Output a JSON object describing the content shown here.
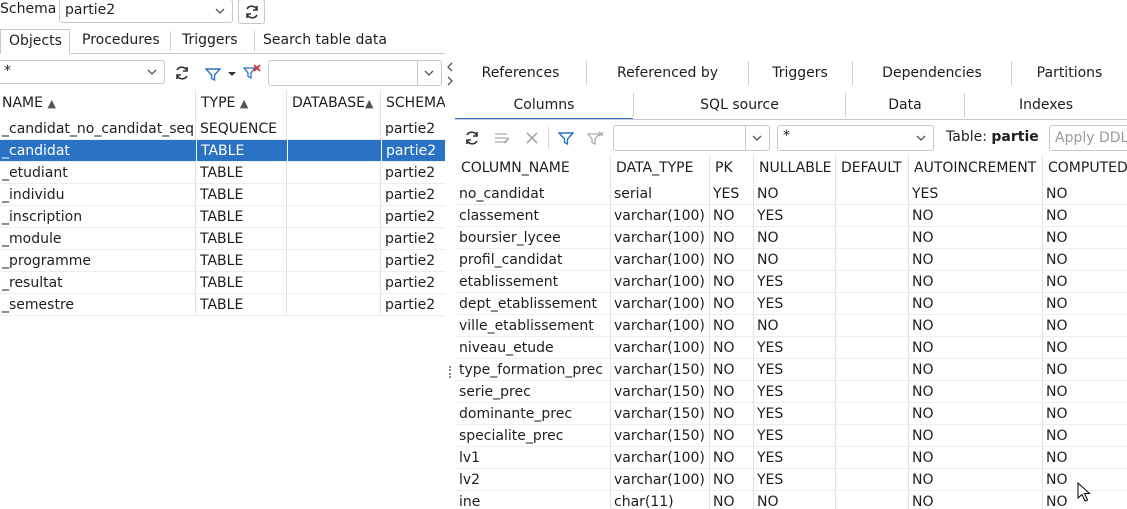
{
  "schema_bar": {
    "label": "Schema",
    "selected": "partie2"
  },
  "nav_tabs": [
    "Objects",
    "Procedures",
    "Triggers",
    "Search table data"
  ],
  "left_filter": {
    "value": "*",
    "search_value": ""
  },
  "objects_table": {
    "headers": [
      "NAME",
      "TYPE",
      "DATABASE",
      "SCHEMA"
    ],
    "rows": [
      {
        "name": "_candidat_no_candidat_seq",
        "type": "SEQUENCE",
        "database": "",
        "schema": "partie2"
      },
      {
        "name": "_candidat",
        "type": "TABLE",
        "database": "",
        "schema": "partie2"
      },
      {
        "name": "_etudiant",
        "type": "TABLE",
        "database": "",
        "schema": "partie2"
      },
      {
        "name": "_individu",
        "type": "TABLE",
        "database": "",
        "schema": "partie2"
      },
      {
        "name": "_inscription",
        "type": "TABLE",
        "database": "",
        "schema": "partie2"
      },
      {
        "name": "_module",
        "type": "TABLE",
        "database": "",
        "schema": "partie2"
      },
      {
        "name": "_programme",
        "type": "TABLE",
        "database": "",
        "schema": "partie2"
      },
      {
        "name": "_resultat",
        "type": "TABLE",
        "database": "",
        "schema": "partie2"
      },
      {
        "name": "_semestre",
        "type": "TABLE",
        "database": "",
        "schema": "partie2"
      }
    ],
    "selected_index": 1
  },
  "detail_tabs_row1": [
    "References",
    "Referenced by",
    "Triggers",
    "Dependencies",
    "Partitions"
  ],
  "detail_tabs_row2": [
    "Columns",
    "SQL source",
    "Data",
    "Indexes"
  ],
  "detail_toolbar": {
    "filter_value": "",
    "pattern_value": "*",
    "table_label": "Table:",
    "table_name": "partie",
    "apply_ddl": "Apply DDL"
  },
  "columns_table": {
    "headers": [
      "COLUMN_NAME",
      "DATA_TYPE",
      "PK",
      "NULLABLE",
      "DEFAULT",
      "AUTOINCREMENT",
      "COMPUTED"
    ],
    "rows": [
      [
        "no_candidat",
        "serial",
        "YES",
        "NO",
        "",
        "YES",
        "NO"
      ],
      [
        "classement",
        "varchar(100)",
        "NO",
        "YES",
        "",
        "NO",
        "NO"
      ],
      [
        "boursier_lycee",
        "varchar(100)",
        "NO",
        "NO",
        "",
        "NO",
        "NO"
      ],
      [
        "profil_candidat",
        "varchar(100)",
        "NO",
        "NO",
        "",
        "NO",
        "NO"
      ],
      [
        "etablissement",
        "varchar(100)",
        "NO",
        "YES",
        "",
        "NO",
        "NO"
      ],
      [
        "dept_etablissement",
        "varchar(100)",
        "NO",
        "YES",
        "",
        "NO",
        "NO"
      ],
      [
        "ville_etablissement",
        "varchar(100)",
        "NO",
        "NO",
        "",
        "NO",
        "NO"
      ],
      [
        "niveau_etude",
        "varchar(100)",
        "NO",
        "YES",
        "",
        "NO",
        "NO"
      ],
      [
        "type_formation_prec",
        "varchar(150)",
        "NO",
        "YES",
        "",
        "NO",
        "NO"
      ],
      [
        "serie_prec",
        "varchar(150)",
        "NO",
        "YES",
        "",
        "NO",
        "NO"
      ],
      [
        "dominante_prec",
        "varchar(150)",
        "NO",
        "YES",
        "",
        "NO",
        "NO"
      ],
      [
        "specialite_prec",
        "varchar(150)",
        "NO",
        "YES",
        "",
        "NO",
        "NO"
      ],
      [
        "lv1",
        "varchar(100)",
        "NO",
        "YES",
        "",
        "NO",
        "NO"
      ],
      [
        "lv2",
        "varchar(100)",
        "NO",
        "YES",
        "",
        "NO",
        "NO"
      ],
      [
        "ine",
        "char(11)",
        "NO",
        "NO",
        "",
        "NO",
        "NO"
      ]
    ]
  }
}
